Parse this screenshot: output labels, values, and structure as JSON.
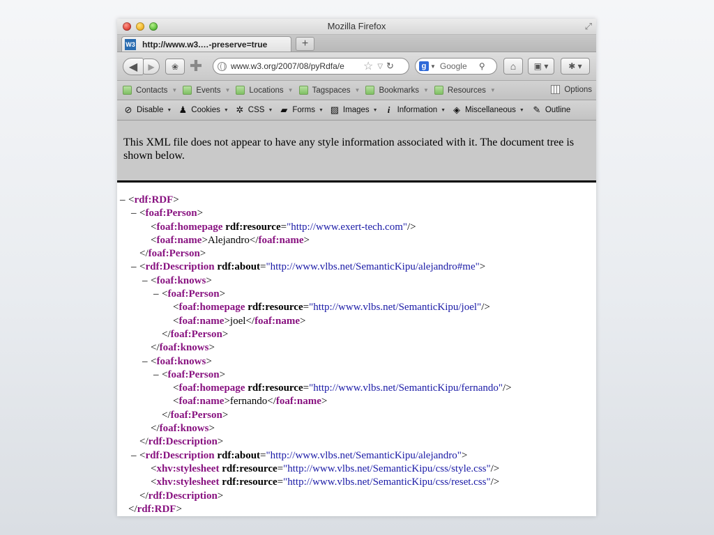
{
  "window": {
    "title": "Mozilla Firefox"
  },
  "tabs": [
    {
      "favicon": "W3",
      "label": "http://www.w3.…-preserve=true"
    }
  ],
  "newtab_label": "+",
  "nav": {
    "url": "www.w3.org/2007/08/pyRdfa/e",
    "search_placeholder": "Google",
    "icons": [
      "back-icon",
      "forward-icon",
      "extension-icon",
      "add-icon",
      "globe-icon",
      "star-icon",
      "dropdown-icon",
      "reload-icon",
      "google-icon",
      "search-icon",
      "home-icon",
      "bookmarks-icon",
      "addon-icon"
    ]
  },
  "bookmarks": {
    "items": [
      "Contacts",
      "Events",
      "Locations",
      "Tagspaces",
      "Bookmarks",
      "Resources"
    ],
    "options_label": "Options"
  },
  "devtoolbar": {
    "items": [
      "Disable",
      "Cookies",
      "CSS",
      "Forms",
      "Images",
      "Information",
      "Miscellaneous",
      "Outline"
    ]
  },
  "notice": "This XML file does not appear to have any style information associated with it. The document tree is shown below.",
  "xml": {
    "lines": [
      {
        "indent": 0,
        "marker": "–",
        "parts": [
          [
            "p",
            "<"
          ],
          [
            "t",
            "rdf:RDF"
          ],
          [
            "p",
            ">"
          ]
        ]
      },
      {
        "indent": 1,
        "marker": "–",
        "parts": [
          [
            "p",
            "<"
          ],
          [
            "t",
            "foaf:Person"
          ],
          [
            "p",
            ">"
          ]
        ]
      },
      {
        "indent": 2,
        "marker": "",
        "parts": [
          [
            "p",
            "<"
          ],
          [
            "t",
            "foaf:homepage"
          ],
          [
            "s",
            " "
          ],
          [
            "a",
            "rdf:resource"
          ],
          [
            "p",
            "="
          ],
          [
            "v",
            "\"http://www.exert-tech.com\""
          ],
          [
            "p",
            "/>"
          ]
        ]
      },
      {
        "indent": 2,
        "marker": "",
        "parts": [
          [
            "p",
            "<"
          ],
          [
            "t",
            "foaf:name"
          ],
          [
            "p",
            ">"
          ],
          [
            "x",
            "Alejandro"
          ],
          [
            "p",
            "</"
          ],
          [
            "t",
            "foaf:name"
          ],
          [
            "p",
            ">"
          ]
        ]
      },
      {
        "indent": 1,
        "marker": "",
        "parts": [
          [
            "p",
            "</"
          ],
          [
            "t",
            "foaf:Person"
          ],
          [
            "p",
            ">"
          ]
        ]
      },
      {
        "indent": 1,
        "marker": "–",
        "parts": [
          [
            "p",
            "<"
          ],
          [
            "t",
            "rdf:Description"
          ],
          [
            "s",
            " "
          ],
          [
            "a",
            "rdf:about"
          ],
          [
            "p",
            "="
          ],
          [
            "v",
            "\"http://www.vlbs.net/SemanticKipu/alejandro#me\""
          ],
          [
            "p",
            ">"
          ]
        ]
      },
      {
        "indent": 2,
        "marker": "–",
        "parts": [
          [
            "p",
            "<"
          ],
          [
            "t",
            "foaf:knows"
          ],
          [
            "p",
            ">"
          ]
        ]
      },
      {
        "indent": 3,
        "marker": "–",
        "parts": [
          [
            "p",
            "<"
          ],
          [
            "t",
            "foaf:Person"
          ],
          [
            "p",
            ">"
          ]
        ]
      },
      {
        "indent": 4,
        "marker": "",
        "parts": [
          [
            "p",
            "<"
          ],
          [
            "t",
            "foaf:homepage"
          ],
          [
            "s",
            " "
          ],
          [
            "a",
            "rdf:resource"
          ],
          [
            "p",
            "="
          ],
          [
            "v",
            "\"http://www.vlbs.net/SemanticKipu/joel\""
          ],
          [
            "p",
            "/>"
          ]
        ]
      },
      {
        "indent": 4,
        "marker": "",
        "parts": [
          [
            "p",
            "<"
          ],
          [
            "t",
            "foaf:name"
          ],
          [
            "p",
            ">"
          ],
          [
            "x",
            "joel"
          ],
          [
            "p",
            "</"
          ],
          [
            "t",
            "foaf:name"
          ],
          [
            "p",
            ">"
          ]
        ]
      },
      {
        "indent": 3,
        "marker": "",
        "parts": [
          [
            "p",
            "</"
          ],
          [
            "t",
            "foaf:Person"
          ],
          [
            "p",
            ">"
          ]
        ]
      },
      {
        "indent": 2,
        "marker": "",
        "parts": [
          [
            "p",
            "</"
          ],
          [
            "t",
            "foaf:knows"
          ],
          [
            "p",
            ">"
          ]
        ]
      },
      {
        "indent": 2,
        "marker": "–",
        "parts": [
          [
            "p",
            "<"
          ],
          [
            "t",
            "foaf:knows"
          ],
          [
            "p",
            ">"
          ]
        ]
      },
      {
        "indent": 3,
        "marker": "–",
        "parts": [
          [
            "p",
            "<"
          ],
          [
            "t",
            "foaf:Person"
          ],
          [
            "p",
            ">"
          ]
        ]
      },
      {
        "indent": 4,
        "marker": "",
        "parts": [
          [
            "p",
            "<"
          ],
          [
            "t",
            "foaf:homepage"
          ],
          [
            "s",
            " "
          ],
          [
            "a",
            "rdf:resource"
          ],
          [
            "p",
            "="
          ],
          [
            "v",
            "\"http://www.vlbs.net/SemanticKipu/fernando\""
          ],
          [
            "p",
            "/>"
          ]
        ]
      },
      {
        "indent": 4,
        "marker": "",
        "parts": [
          [
            "p",
            "<"
          ],
          [
            "t",
            "foaf:name"
          ],
          [
            "p",
            ">"
          ],
          [
            "x",
            "fernando"
          ],
          [
            "p",
            "</"
          ],
          [
            "t",
            "foaf:name"
          ],
          [
            "p",
            ">"
          ]
        ]
      },
      {
        "indent": 3,
        "marker": "",
        "parts": [
          [
            "p",
            "</"
          ],
          [
            "t",
            "foaf:Person"
          ],
          [
            "p",
            ">"
          ]
        ]
      },
      {
        "indent": 2,
        "marker": "",
        "parts": [
          [
            "p",
            "</"
          ],
          [
            "t",
            "foaf:knows"
          ],
          [
            "p",
            ">"
          ]
        ]
      },
      {
        "indent": 1,
        "marker": "",
        "parts": [
          [
            "p",
            "</"
          ],
          [
            "t",
            "rdf:Description"
          ],
          [
            "p",
            ">"
          ]
        ]
      },
      {
        "indent": 1,
        "marker": "–",
        "parts": [
          [
            "p",
            "<"
          ],
          [
            "t",
            "rdf:Description"
          ],
          [
            "s",
            " "
          ],
          [
            "a",
            "rdf:about"
          ],
          [
            "p",
            "="
          ],
          [
            "v",
            "\"http://www.vlbs.net/SemanticKipu/alejandro\""
          ],
          [
            "p",
            ">"
          ]
        ]
      },
      {
        "indent": 2,
        "marker": "",
        "parts": [
          [
            "p",
            "<"
          ],
          [
            "t",
            "xhv:stylesheet"
          ],
          [
            "s",
            " "
          ],
          [
            "a",
            "rdf:resource"
          ],
          [
            "p",
            "="
          ],
          [
            "v",
            "\"http://www.vlbs.net/SemanticKipu/css/style.css\""
          ],
          [
            "p",
            "/>"
          ]
        ]
      },
      {
        "indent": 2,
        "marker": "",
        "parts": [
          [
            "p",
            "<"
          ],
          [
            "t",
            "xhv:stylesheet"
          ],
          [
            "s",
            " "
          ],
          [
            "a",
            "rdf:resource"
          ],
          [
            "p",
            "="
          ],
          [
            "v",
            "\"http://www.vlbs.net/SemanticKipu/css/reset.css\""
          ],
          [
            "p",
            "/>"
          ]
        ]
      },
      {
        "indent": 1,
        "marker": "",
        "parts": [
          [
            "p",
            "</"
          ],
          [
            "t",
            "rdf:Description"
          ],
          [
            "p",
            ">"
          ]
        ]
      },
      {
        "indent": 0,
        "marker": "",
        "parts": [
          [
            "p",
            "</"
          ],
          [
            "t",
            "rdf:RDF"
          ],
          [
            "p",
            ">"
          ]
        ]
      }
    ]
  },
  "colors": {
    "tag": "#881280",
    "attr_value": "#1a1aa6",
    "notice_bg": "#c9c9c9"
  }
}
